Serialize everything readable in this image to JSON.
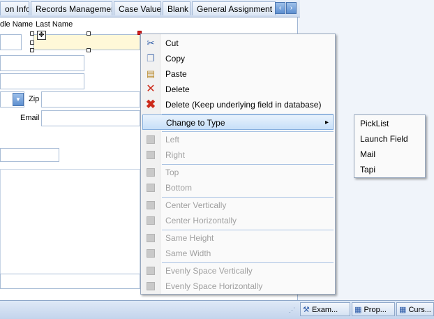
{
  "tabs": [
    "on Info",
    "Records Management",
    "Case Value",
    "Blank",
    "General Assignment Inf"
  ],
  "tab_nav": {
    "prev": "‹",
    "next": "›"
  },
  "form": {
    "labels": {
      "middle_name": "dle Name",
      "last_name": "Last Name",
      "zip": "Zip",
      "email": "Email"
    }
  },
  "context_menu": {
    "items": [
      {
        "label": "Cut",
        "icon": "scissors-icon",
        "enabled": true
      },
      {
        "label": "Copy",
        "icon": "copy-icon",
        "enabled": true
      },
      {
        "label": "Paste",
        "icon": "paste-icon",
        "enabled": true
      },
      {
        "label": "Delete",
        "icon": "delete-x-icon",
        "enabled": true
      },
      {
        "label": "Delete (Keep underlying field in database)",
        "icon": "delete-red-x-icon",
        "enabled": true
      },
      {
        "label": "Change to Type",
        "icon": "",
        "enabled": true,
        "submenu": true
      },
      {
        "label": "Left",
        "icon": "align-left-icon",
        "enabled": false
      },
      {
        "label": "Right",
        "icon": "align-right-icon",
        "enabled": false
      },
      {
        "label": "Top",
        "icon": "align-top-icon",
        "enabled": false
      },
      {
        "label": "Bottom",
        "icon": "align-bottom-icon",
        "enabled": false
      },
      {
        "label": "Center Vertically",
        "icon": "center-vertical-icon",
        "enabled": false
      },
      {
        "label": "Center Horizontally",
        "icon": "center-horizontal-icon",
        "enabled": false
      },
      {
        "label": "Same Height",
        "icon": "same-height-icon",
        "enabled": false
      },
      {
        "label": "Same Width",
        "icon": "same-width-icon",
        "enabled": false
      },
      {
        "label": "Evenly Space Vertically",
        "icon": "space-vertical-icon",
        "enabled": false
      },
      {
        "label": "Evenly Space Horizontally",
        "icon": "space-horizontal-icon",
        "enabled": false
      }
    ],
    "submenu_arrow": "▸"
  },
  "submenu": {
    "items": [
      "PickList",
      "Launch Field",
      "Mail",
      "Tapi"
    ]
  },
  "bottom_tabs": [
    "Exam...",
    "Prop...",
    "Curs..."
  ],
  "colors": {
    "accent": "#4a76b2",
    "selected_field": "#fff8d8",
    "delete_red": "#cc2a1a"
  }
}
